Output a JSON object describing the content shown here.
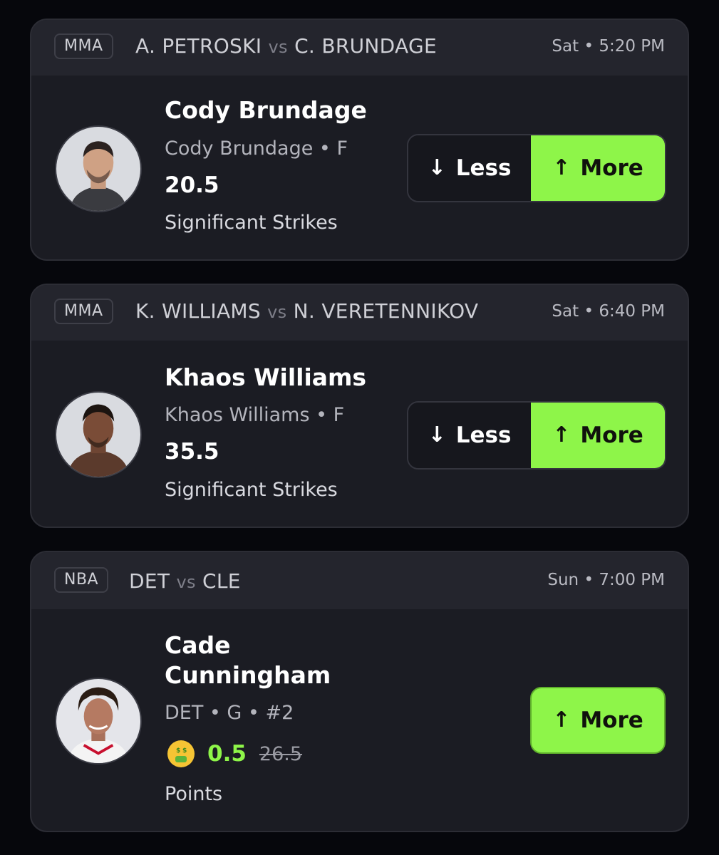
{
  "colors": {
    "background": "#06070c",
    "card": "#1b1c23",
    "card_header": "#24252d",
    "accent_green": "#8ef549",
    "muted_text": "#b3b4bc"
  },
  "cards": [
    {
      "league": "MMA",
      "team_a": "A. PETROSKI",
      "vs": "vs",
      "team_b": "C. BRUNDAGE",
      "time": "Sat • 5:20 PM",
      "player_name": "Cody Brundage",
      "meta": "Cody Brundage • F",
      "line": "20.5",
      "stat": "Significant Strikes",
      "less_label": "Less",
      "more_label": "More"
    },
    {
      "league": "MMA",
      "team_a": "K. WILLIAMS",
      "vs": "vs",
      "team_b": "N. VERETENNIKOV",
      "time": "Sat • 6:40 PM",
      "player_name": "Khaos Williams",
      "meta": "Khaos Williams • F",
      "line": "35.5",
      "stat": "Significant Strikes",
      "less_label": "Less",
      "more_label": "More"
    },
    {
      "league": "NBA",
      "team_a": "DET",
      "vs": "vs",
      "team_b": "CLE",
      "time": "Sun • 7:00 PM",
      "player_name_line1": "Cade",
      "player_name_line2": "Cunningham",
      "meta": "DET • G • #2",
      "discount_line": "0.5",
      "original_line": "26.5",
      "icon": "money-mouth-emoji",
      "stat": "Points",
      "more_label": "More"
    }
  ],
  "icons": {
    "down_arrow": "↓",
    "up_arrow": "↑"
  }
}
